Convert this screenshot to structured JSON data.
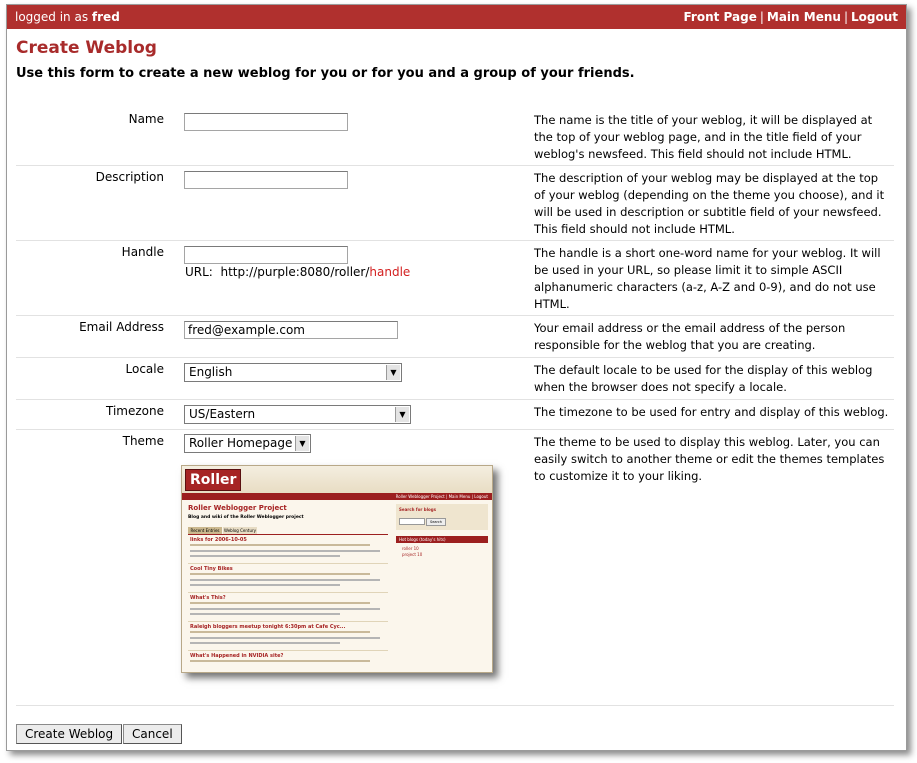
{
  "topbar": {
    "logged_prefix": "logged in as",
    "username": "fred",
    "links": [
      "Front Page",
      "Main Menu",
      "Logout"
    ],
    "separator": "|"
  },
  "page": {
    "title": "Create Weblog",
    "subtitle": "Use this form to create a new weblog for you or for you and a group of your friends."
  },
  "fields": {
    "name": {
      "label": "Name",
      "value": "",
      "help": "The name is the title of your weblog, it will be displayed at the top of your weblog page, and in the title field of your weblog's newsfeed. This field should not include HTML."
    },
    "description": {
      "label": "Description",
      "value": "",
      "help": "The description of your weblog may be displayed at the top of your weblog (depending on the theme you choose), and it will be used in description or subtitle field of your newsfeed. This field should not include HTML."
    },
    "handle": {
      "label": "Handle",
      "value": "",
      "url_prefix": "URL:  http://purple:8080/roller/",
      "url_handle": "handle",
      "help": "The handle is a short one-word name for your weblog. It will be used in your URL, so please limit it to simple ASCII alphanumeric characters (a-z, A-Z and 0-9), and do not use HTML."
    },
    "email": {
      "label": "Email Address",
      "value": "fred@example.com",
      "help": "Your email address or the email address of the person responsible for the weblog that you are creating."
    },
    "locale": {
      "label": "Locale",
      "value": "English",
      "help": "The default locale to be used for the display of this weblog when the browser does not specify a locale."
    },
    "timezone": {
      "label": "Timezone",
      "value": "US/Eastern",
      "help": "The timezone to be used for entry and display of this weblog."
    },
    "theme": {
      "label": "Theme",
      "value": "Roller Homepage",
      "help": "The theme to be used to display this weblog. Later, you can easily switch to another theme or edit the themes templates to customize it to your liking."
    }
  },
  "preview": {
    "logo": "Roller",
    "bar_links": "Roller Weblogger Project | Main Menu | Logout",
    "title": "Roller Weblogger Project",
    "subtitle": "Blog and wiki of the Roller Weblogger project",
    "tabs": [
      "Recent Entries",
      "Weblog Century"
    ],
    "entries": [
      "links for 2006-10-05",
      "Cool Tiny Bikes",
      "What's This?",
      "Raleigh bloggers meetup tonight 6:30pm at Cafe Cyc...",
      "What's Happened in NVIDIA site?"
    ],
    "search_heading": "Search for blogs",
    "search_button": "Search",
    "side_heading": "Hot blogs (today's hits)",
    "side_items": [
      "roller 10",
      "project 10"
    ]
  },
  "buttons": {
    "create": "Create Weblog",
    "cancel": "Cancel"
  }
}
